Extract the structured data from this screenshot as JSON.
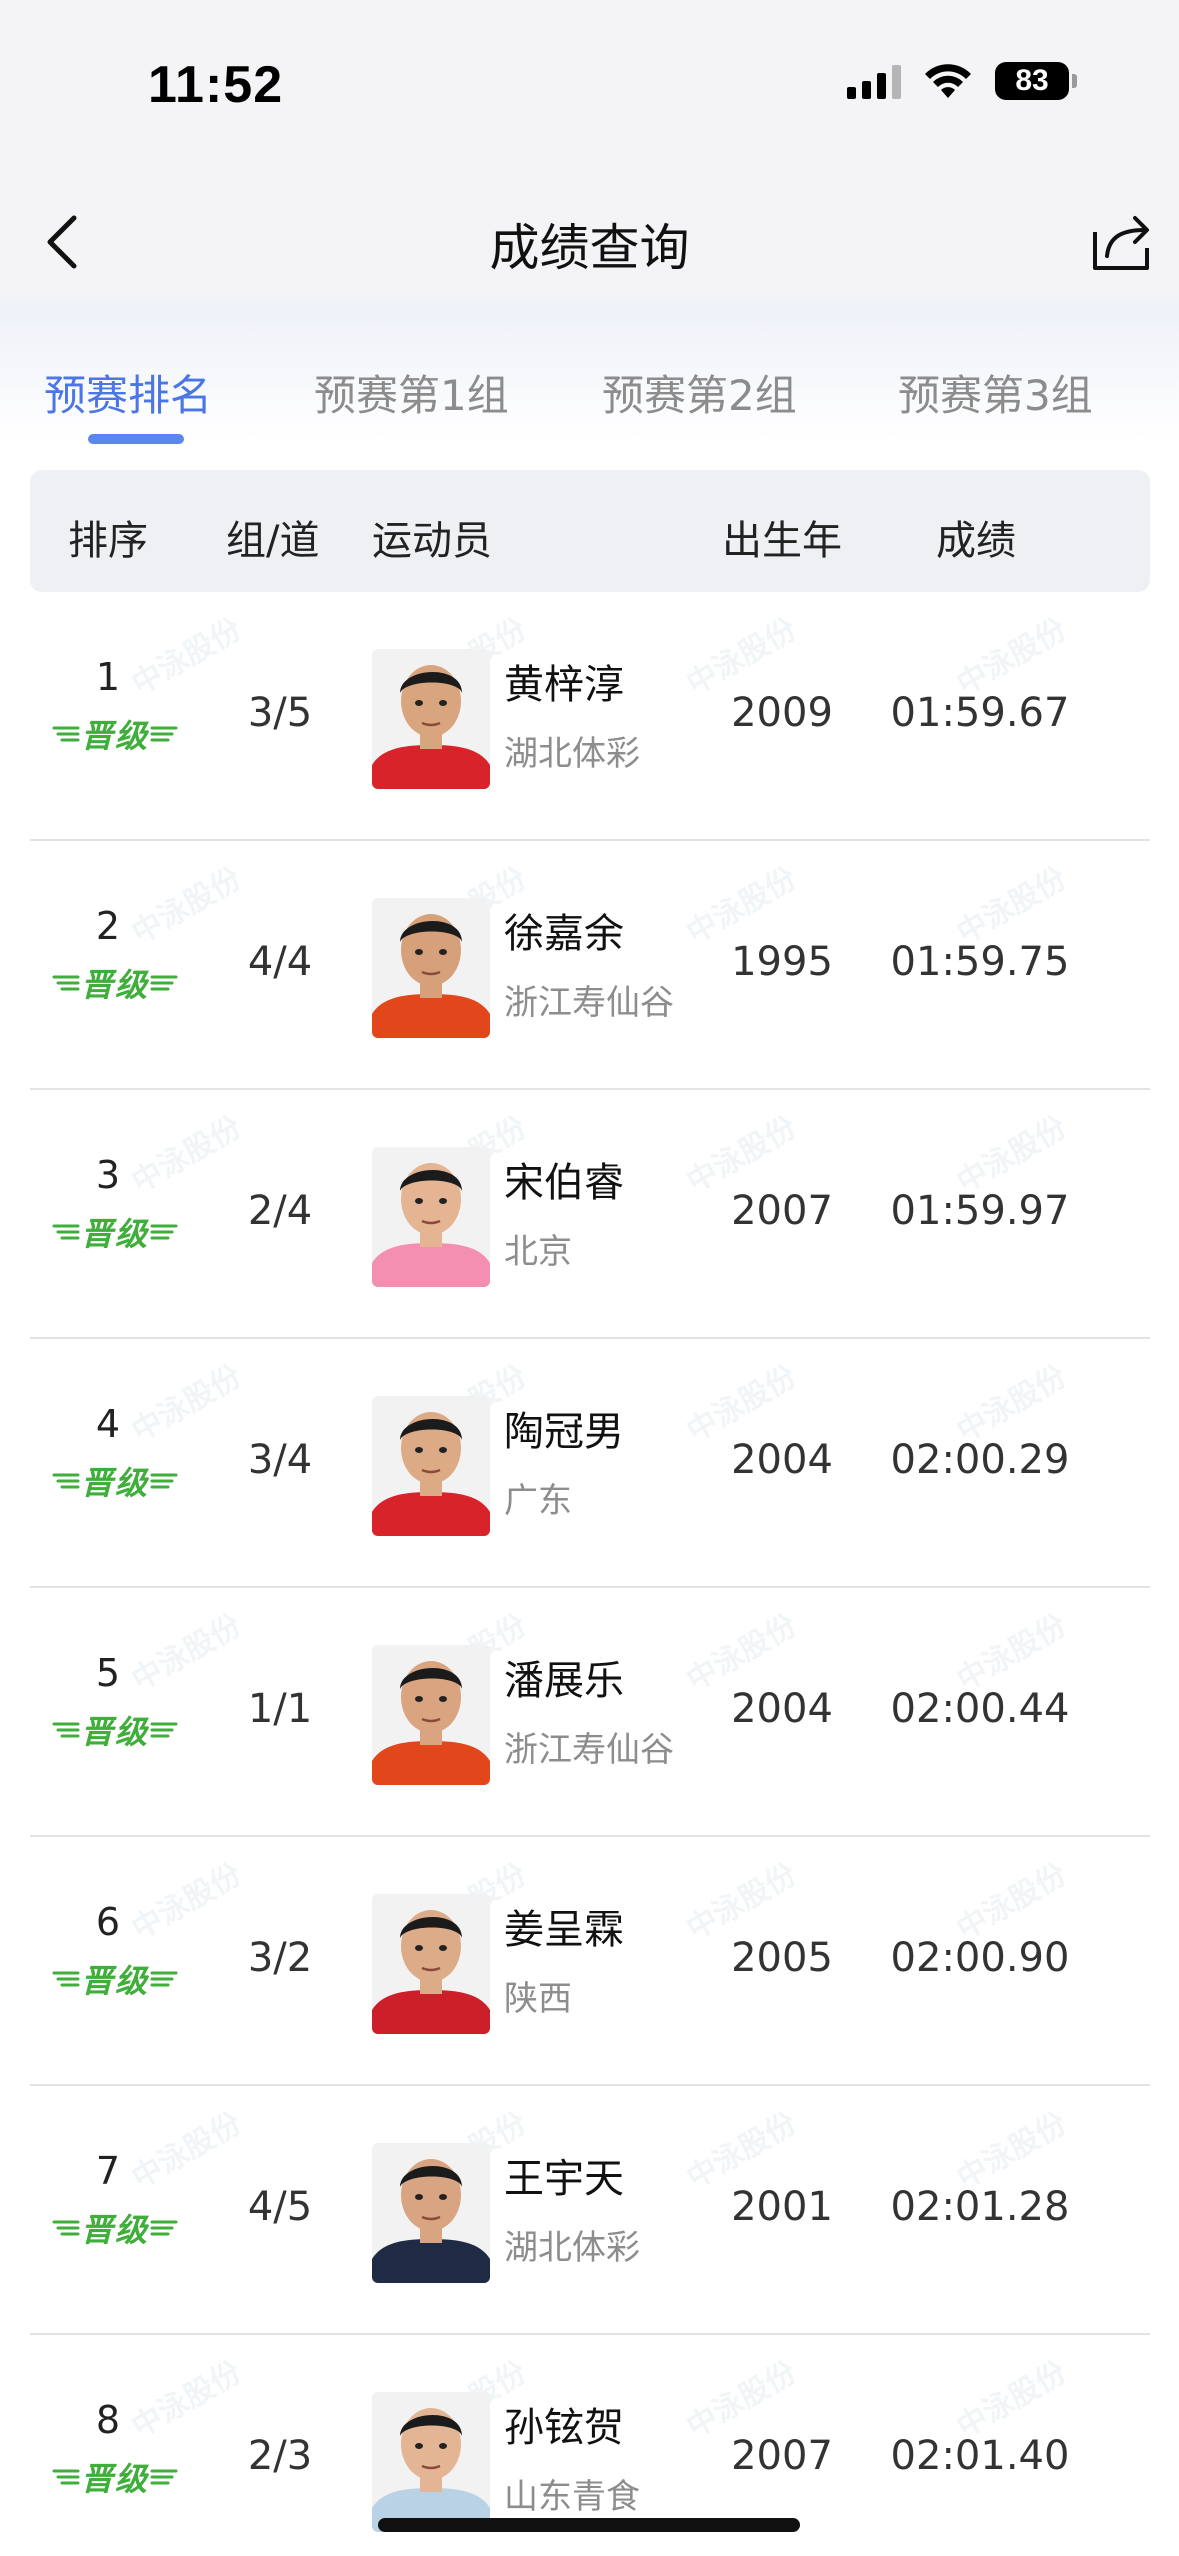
{
  "status_bar": {
    "time": "11:52",
    "battery": "83"
  },
  "nav": {
    "title": "成绩查询"
  },
  "tabs": [
    {
      "label": "预赛排名",
      "active": true
    },
    {
      "label": "预赛第1组",
      "active": false
    },
    {
      "label": "预赛第2组",
      "active": false
    },
    {
      "label": "预赛第3组",
      "active": false
    }
  ],
  "table": {
    "headers": {
      "rank": "排序",
      "lane": "组/道",
      "athlete": "运动员",
      "birth_year": "出生年",
      "result": "成绩"
    },
    "watermark": "中泳股份",
    "rows": [
      {
        "rank": "1",
        "badge": "晋级",
        "lane": "3/5",
        "name": "黄梓淳",
        "team": "湖北体彩",
        "year": "2009",
        "result": "01:59.67",
        "shirt": "#d8232a",
        "skin": "#d9a57e"
      },
      {
        "rank": "2",
        "badge": "晋级",
        "lane": "4/4",
        "name": "徐嘉余",
        "team": "浙江寿仙谷",
        "year": "1995",
        "result": "01:59.75",
        "shirt": "#e2471b",
        "skin": "#d6a07a"
      },
      {
        "rank": "3",
        "badge": "晋级",
        "lane": "2/4",
        "name": "宋伯睿",
        "team": "北京",
        "year": "2007",
        "result": "01:59.97",
        "shirt": "#f48fb1",
        "skin": "#e4b493"
      },
      {
        "rank": "4",
        "badge": "晋级",
        "lane": "3/4",
        "name": "陶冠男",
        "team": "广东",
        "year": "2004",
        "result": "02:00.29",
        "shirt": "#d8232a",
        "skin": "#dcab86"
      },
      {
        "rank": "5",
        "badge": "晋级",
        "lane": "1/1",
        "name": "潘展乐",
        "team": "浙江寿仙谷",
        "year": "2004",
        "result": "02:00.44",
        "shirt": "#e2471b",
        "skin": "#d9a47f"
      },
      {
        "rank": "6",
        "badge": "晋级",
        "lane": "3/2",
        "name": "姜呈霖",
        "team": "陕西",
        "year": "2005",
        "result": "02:00.90",
        "shirt": "#cc1f2a",
        "skin": "#dcab88"
      },
      {
        "rank": "7",
        "badge": "晋级",
        "lane": "4/5",
        "name": "王宇天",
        "team": "湖北体彩",
        "year": "2001",
        "result": "02:01.28",
        "shirt": "#1f2a44",
        "skin": "#d8a482"
      },
      {
        "rank": "8",
        "badge": "晋级",
        "lane": "2/3",
        "name": "孙铉贺",
        "team": "山东青食",
        "year": "2007",
        "result": "02:01.40",
        "shirt": "#b9d2e6",
        "skin": "#e3b594"
      }
    ]
  }
}
